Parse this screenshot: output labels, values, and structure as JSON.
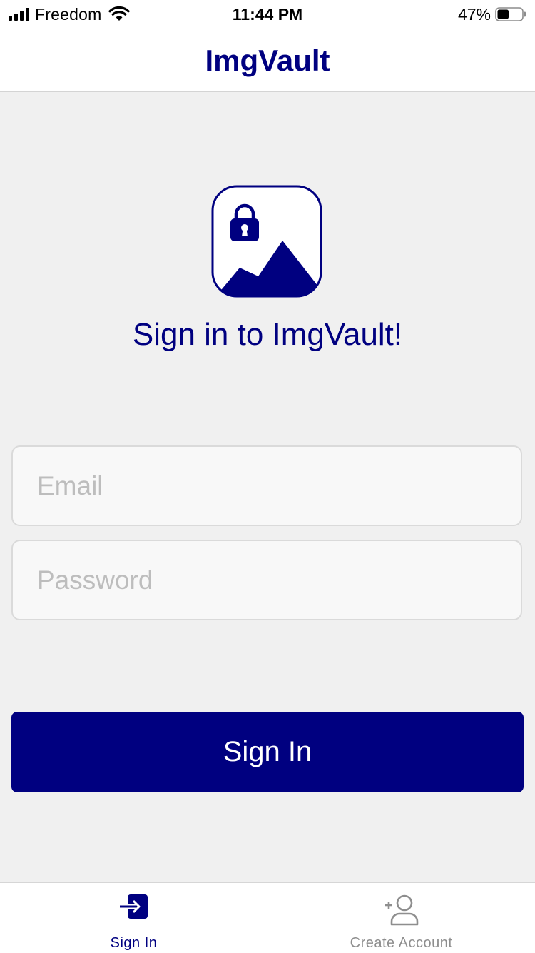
{
  "status_bar": {
    "carrier": "Freedom",
    "time": "11:44 PM",
    "battery_percent": "47%",
    "battery_level": 0.47,
    "signal_strength": 4,
    "icons": [
      "signal-bars-icon",
      "wifi-icon",
      "battery-icon"
    ]
  },
  "nav": {
    "title": "ImgVault"
  },
  "hero": {
    "logo_icon": "locked-image-icon",
    "heading": "Sign in to ImgVault!"
  },
  "form": {
    "email_placeholder": "Email",
    "email_value": "",
    "password_placeholder": "Password",
    "password_value": "",
    "submit_label": "Sign In"
  },
  "tabs": [
    {
      "label": "Sign In",
      "icon": "sign-in-icon",
      "active": true
    },
    {
      "label": "Create Account",
      "icon": "add-user-icon",
      "active": false
    }
  ],
  "colors": {
    "accent": "#000080",
    "background": "#f0f0f0",
    "surface": "#ffffff",
    "inactive_tab": "#8e8e8e",
    "placeholder": "#bdbdbd"
  }
}
